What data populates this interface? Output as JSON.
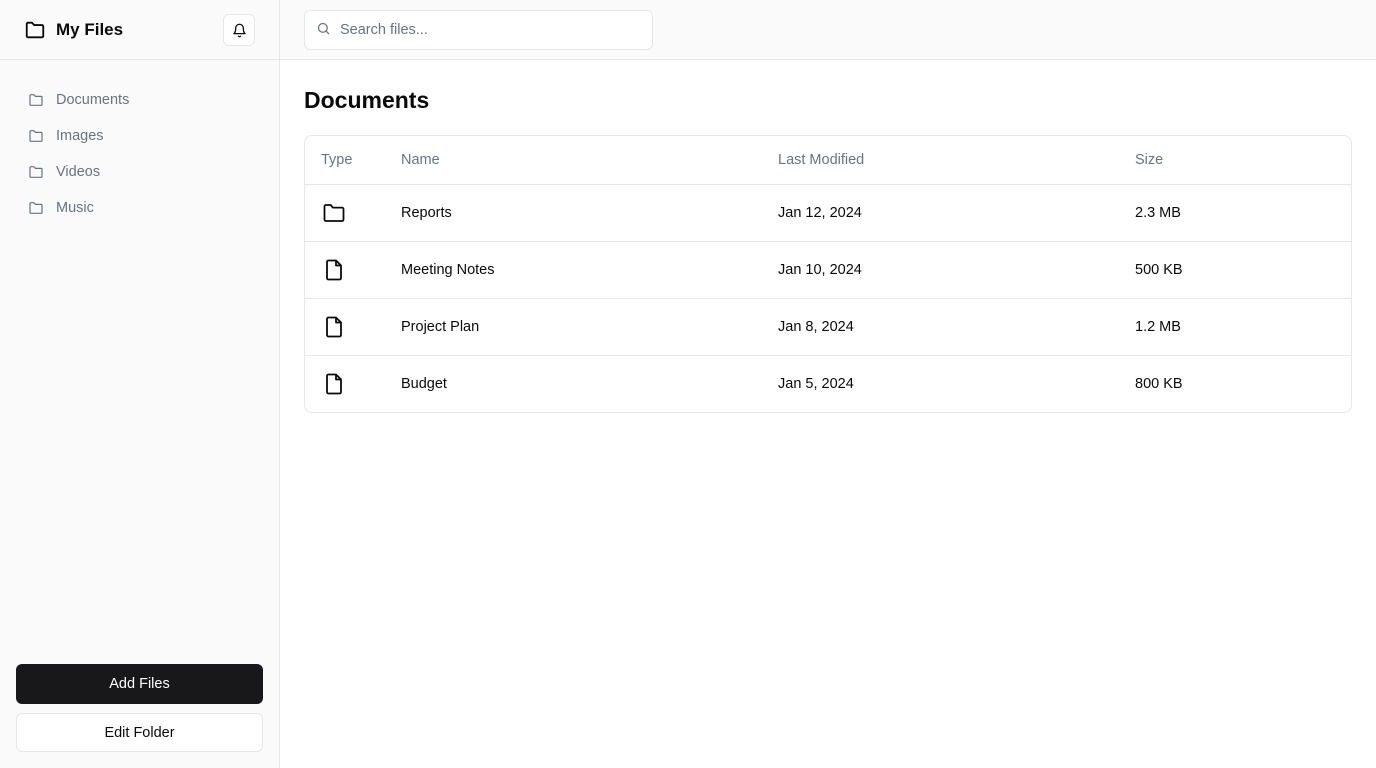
{
  "sidebar": {
    "title": "My Files",
    "items": [
      {
        "label": "Documents",
        "icon": "folder-icon"
      },
      {
        "label": "Images",
        "icon": "folder-icon"
      },
      {
        "label": "Videos",
        "icon": "folder-icon"
      },
      {
        "label": "Music",
        "icon": "folder-icon"
      }
    ],
    "add_files_label": "Add Files",
    "edit_folder_label": "Edit Folder"
  },
  "search": {
    "placeholder": "Search files...",
    "value": ""
  },
  "main": {
    "title": "Documents",
    "table": {
      "headers": {
        "type": "Type",
        "name": "Name",
        "modified": "Last Modified",
        "size": "Size"
      },
      "rows": [
        {
          "type": "folder",
          "icon": "folder-icon",
          "name": "Reports",
          "modified": "Jan 12, 2024",
          "size": "2.3 MB"
        },
        {
          "type": "file",
          "icon": "file-icon",
          "name": "Meeting Notes",
          "modified": "Jan 10, 2024",
          "size": "500 KB"
        },
        {
          "type": "file",
          "icon": "file-icon",
          "name": "Project Plan",
          "modified": "Jan 8, 2024",
          "size": "1.2 MB"
        },
        {
          "type": "file",
          "icon": "file-icon",
          "name": "Budget",
          "modified": "Jan 5, 2024",
          "size": "800 KB"
        }
      ]
    }
  },
  "colors": {
    "primary_button": "#18181b",
    "sidebar_bg": "#f9faf9",
    "border": "#e5e7eb",
    "muted_text": "#6b7280"
  }
}
